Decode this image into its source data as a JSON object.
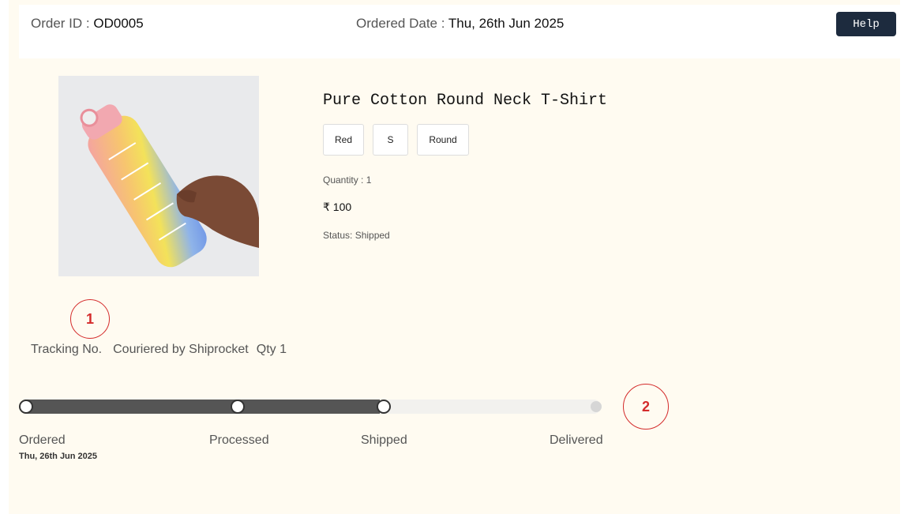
{
  "header": {
    "order_id_label": "Order ID : ",
    "order_id": "OD0005",
    "ordered_date_label": "Ordered Date : ",
    "ordered_date": "Thu, 26th Jun 2025",
    "help_label": "Help"
  },
  "product": {
    "image_icon": "water-bottle-photo",
    "title": "Pure Cotton Round Neck T-Shirt",
    "options": [
      "Red",
      "S",
      "Round"
    ],
    "quantity": "Quantity : 1",
    "price": "₹ 100",
    "status": "Status: Shipped"
  },
  "markers": {
    "one": "1",
    "two": "2"
  },
  "shipping": {
    "tracking": "Tracking No.",
    "courier": "Couriered by Shiprocket",
    "qty": "Qty 1"
  },
  "progress": {
    "steps": [
      "Ordered",
      "Processed",
      "Shipped",
      "Delivered"
    ],
    "completed_steps": 3,
    "fill_fraction": 0.62,
    "ordered_date": "Thu, 26th Jun 2025"
  },
  "colors": {
    "accent": "#1d2b3e",
    "marker": "#d42b2b",
    "progress_fill": "#555555",
    "background": "#fffbf1"
  }
}
